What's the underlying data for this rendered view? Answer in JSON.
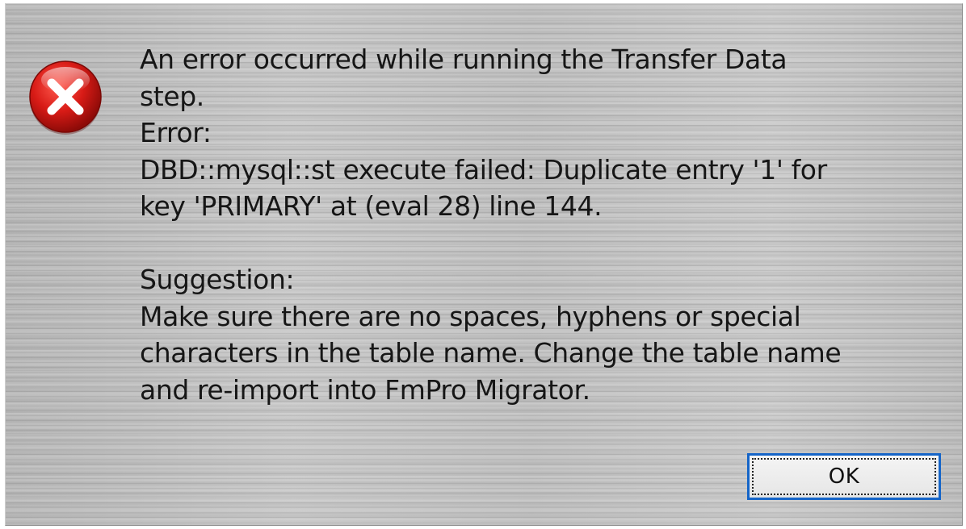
{
  "dialog": {
    "icon": "error-icon",
    "message_lines": [
      "An error occurred while running the Transfer Data",
      "step.",
      "Error:",
      "DBD::mysql::st execute failed: Duplicate entry '1' for",
      "key 'PRIMARY' at (eval 28) line 144.",
      "",
      "Suggestion:",
      "Make sure there are no spaces, hyphens or special",
      "characters in the table name. Change the table name",
      "and re-import into FmPro Migrator."
    ],
    "ok_label": "OK"
  },
  "colors": {
    "icon_red": "#d01818",
    "button_focus_border": "#1565c8",
    "text": "#161616"
  }
}
